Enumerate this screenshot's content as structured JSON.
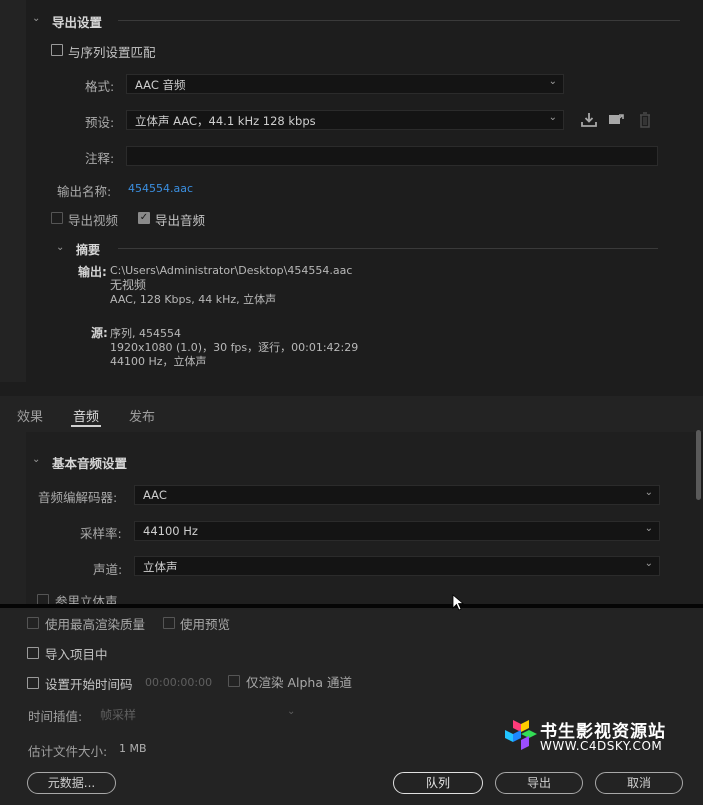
{
  "export_settings": {
    "section_title": "导出设置",
    "match_sequence_label": "与序列设置匹配",
    "format_label": "格式:",
    "format_value": "AAC 音频",
    "preset_label": "预设:",
    "preset_value": "立体声 AAC，44.1 kHz 128 kbps",
    "comment_label": "注释:",
    "comment_value": "",
    "output_name_label": "输出名称:",
    "output_name_value": "454554.aac",
    "export_video_label": "导出视频",
    "export_audio_label": "导出音频",
    "summary": {
      "title": "摘要",
      "output_label": "输出:",
      "output_path": "C:\\Users\\Administrator\\Desktop\\454554.aac",
      "output_line2": "无视频",
      "output_line3": "AAC, 128 Kbps, 44  kHz, 立体声",
      "source_label": "源:",
      "source_line1": "序列, 454554",
      "source_line2": "1920x1080 (1.0)，30 fps，逐行，00:01:42:29",
      "source_line3": "44100 Hz，立体声"
    }
  },
  "tabs": [
    "效果",
    "音频",
    "发布"
  ],
  "active_tab": "音频",
  "audio": {
    "section_title": "基本音频设置",
    "codec_label": "音频编解码器:",
    "codec_value": "AAC",
    "sample_rate_label": "采样率:",
    "sample_rate_value": "44100 Hz",
    "channels_label": "声道:",
    "channels_value": "立体声",
    "partial_label": "参里立体声"
  },
  "bottom": {
    "max_render_label": "使用最高渲染质量",
    "use_preview_label": "使用预览",
    "import_label": "导入项目中",
    "set_start_tc_label": "设置开始时间码",
    "start_tc_value": "00:00:00:00",
    "alpha_only_label": "仅渲染 Alpha 通道",
    "time_interp_label": "时间插值:",
    "time_interp_value": "帧采样",
    "file_size_label": "估计文件大小:",
    "file_size_value": "1 MB",
    "metadata_button": "元数据...",
    "queue_button": "队列",
    "export_button": "导出",
    "cancel_button": "取消"
  },
  "watermark": {
    "line1": "书生影视资源站",
    "line2": "WWW.C4DSKY.COM"
  }
}
